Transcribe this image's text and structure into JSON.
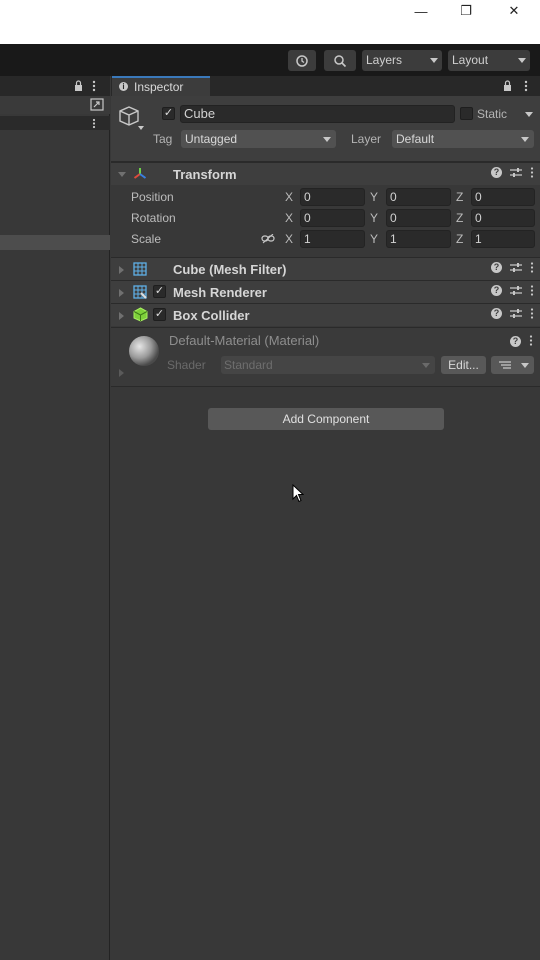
{
  "window": {
    "minimize_glyph": "—",
    "restore_glyph": "❐",
    "close_glyph": "✕"
  },
  "toolbar": {
    "history_icon": "history-icon",
    "search_icon": "search-icon",
    "layers_label": "Layers",
    "layout_label": "Layout"
  },
  "inspector": {
    "tab_label": "Inspector",
    "object_name": "Cube",
    "object_active": true,
    "static_label": "Static",
    "tag_label": "Tag",
    "tag_value": "Untagged",
    "layer_label": "Layer",
    "layer_value": "Default",
    "transform": {
      "title": "Transform",
      "rows": [
        {
          "label": "Position",
          "x": "0",
          "y": "0",
          "z": "0"
        },
        {
          "label": "Rotation",
          "x": "0",
          "y": "0",
          "z": "0"
        },
        {
          "label": "Scale",
          "x": "1",
          "y": "1",
          "z": "1"
        }
      ],
      "axis_x": "X",
      "axis_y": "Y",
      "axis_z": "Z"
    },
    "components": [
      {
        "title": "Cube (Mesh Filter)",
        "has_checkbox": false
      },
      {
        "title": "Mesh Renderer",
        "has_checkbox": true
      },
      {
        "title": "Box Collider",
        "has_checkbox": true
      }
    ],
    "material": {
      "title": "Default-Material (Material)",
      "shader_label": "Shader",
      "shader_value": "Standard",
      "edit_label": "Edit..."
    },
    "add_component_label": "Add Component"
  },
  "colors": {
    "accent": "#3a79bb",
    "panel_bg": "#383838",
    "header_bg": "#3e3e3e",
    "toolbar_bg": "#191919"
  }
}
